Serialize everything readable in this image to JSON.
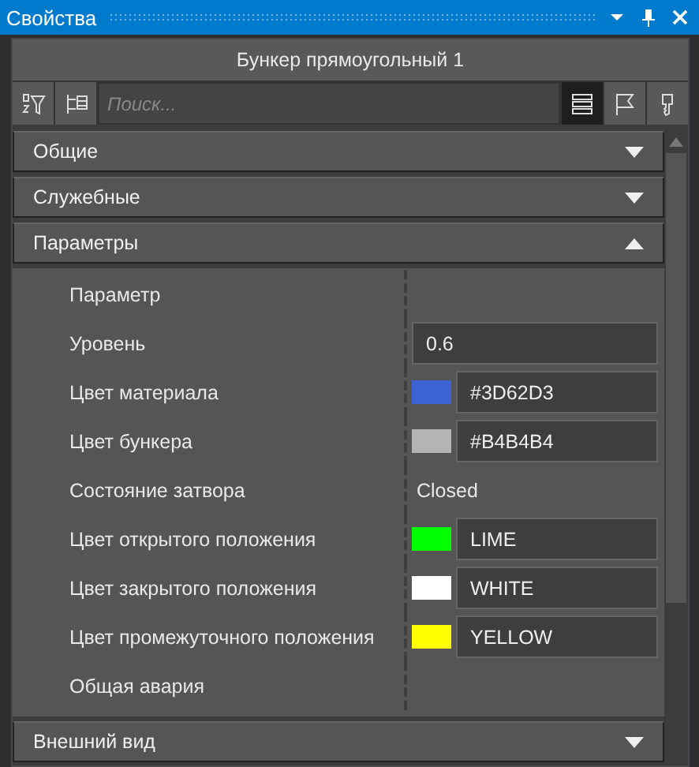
{
  "window": {
    "title": "Свойства"
  },
  "object_title": "Бункер прямоугольный 1",
  "toolbar": {
    "search": {
      "placeholder": "Поиск..."
    },
    "left_buttons": [
      {
        "kind": "sort-filter",
        "selected": false
      },
      {
        "kind": "tree",
        "selected": false
      }
    ],
    "right_buttons": [
      {
        "kind": "list",
        "selected": true
      },
      {
        "kind": "flag",
        "selected": false
      },
      {
        "kind": "key",
        "selected": false
      }
    ]
  },
  "sections": [
    {
      "title": "Общие",
      "expanded": false
    },
    {
      "title": "Служебные",
      "expanded": false
    },
    {
      "title": "Параметры",
      "expanded": true,
      "rows": [
        {
          "kind": "header",
          "label": "Параметр"
        },
        {
          "kind": "text",
          "label": "Уровень",
          "value": "0.6"
        },
        {
          "kind": "color",
          "label": "Цвет материала",
          "value": "#3D62D3",
          "color": "#3d62d3"
        },
        {
          "kind": "color",
          "label": "Цвет бункера",
          "value": "#B4B4B4",
          "color": "#b4b4b4"
        },
        {
          "kind": "plain",
          "label": "Состояние затвора",
          "value": "Closed"
        },
        {
          "kind": "color",
          "label": "Цвет открытого положения",
          "value": "LIME",
          "color": "#00ff00"
        },
        {
          "kind": "color",
          "label": "Цвет закрытого положения",
          "value": "WHITE",
          "color": "#ffffff"
        },
        {
          "kind": "color",
          "label": "Цвет промежуточного положения",
          "value": "YELLOW",
          "color": "#ffff00"
        },
        {
          "kind": "header",
          "label": "Общая авария"
        }
      ]
    },
    {
      "title": "Внешний вид",
      "expanded": false
    }
  ]
}
